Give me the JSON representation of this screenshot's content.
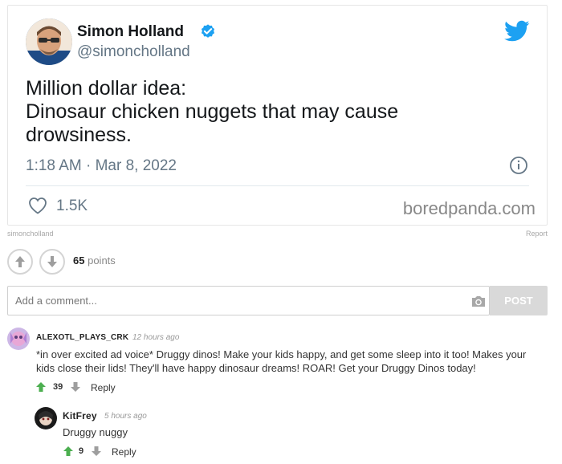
{
  "tweet": {
    "author_name": "Simon Holland",
    "handle": "@simoncholland",
    "text_lines": [
      "Million dollar idea:",
      "Dinosaur chicken nuggets that may cause",
      "drowsiness."
    ],
    "timestamp": "1:18 AM · Mar 8, 2022",
    "likes": "1.5K",
    "watermark": "boredpanda.com"
  },
  "post": {
    "credit": "simoncholland",
    "report_label": "Report",
    "points_count": "65",
    "points_label": "points"
  },
  "comment_form": {
    "placeholder": "Add a comment...",
    "post_label": "POST"
  },
  "comments": [
    {
      "username": "ALEXOTL_PLAYS_CRK",
      "time": "12 hours ago",
      "text_lines": [
        "*in over excited ad voice* Druggy dinos! Make your kids happy, and get some sleep into it too! Makes your",
        "kids close their lids! They'll have happy dinosaur dreams! ROAR! Get your Druggy Dinos today!"
      ],
      "score": "39",
      "reply_label": "Reply"
    },
    {
      "username": "KitFrey",
      "time": "5 hours ago",
      "text": "Druggy nuggy",
      "score": "9",
      "reply_label": "Reply"
    }
  ],
  "colors": {
    "twitter_blue": "#1da1f2",
    "upvote_green": "#4caf50",
    "downvote_gray": "#9e9e9e"
  }
}
